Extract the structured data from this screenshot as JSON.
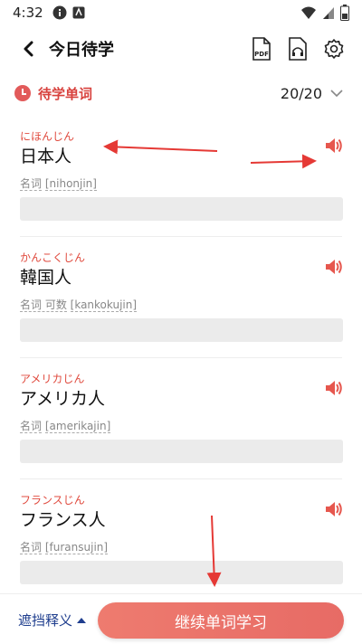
{
  "status_bar": {
    "time": "4:32"
  },
  "header": {
    "title": "今日待学",
    "pdf_label": "PDF"
  },
  "subheader": {
    "label": "待学单词",
    "count": "20/20"
  },
  "words": [
    {
      "kana": "にほんじん",
      "kanji": "日本人",
      "pos": "名词",
      "romaji": "[nihonjin]"
    },
    {
      "kana": "かんこくじん",
      "kanji": "韓国人",
      "pos": "名词 可数",
      "romaji": "[kankokujin]"
    },
    {
      "kana": "アメリカじん",
      "kanji": "アメリカ人",
      "pos": "名词",
      "romaji": "[amerikajin]"
    },
    {
      "kana": "フランスじん",
      "kanji": "フランス人",
      "pos": "名词",
      "romaji": "[furansujin]"
    }
  ],
  "bottom": {
    "mask_label": "遮挡释义",
    "continue_label": "继续单词学习"
  },
  "colors": {
    "accent": "#e04b3f",
    "annotation": "#e53935",
    "mask_text": "#1f3e8e"
  },
  "icons": [
    "back-icon",
    "pdf-icon",
    "headphone-icon",
    "gear-icon",
    "clock-icon",
    "chevron-down-icon",
    "speaker-icon"
  ]
}
